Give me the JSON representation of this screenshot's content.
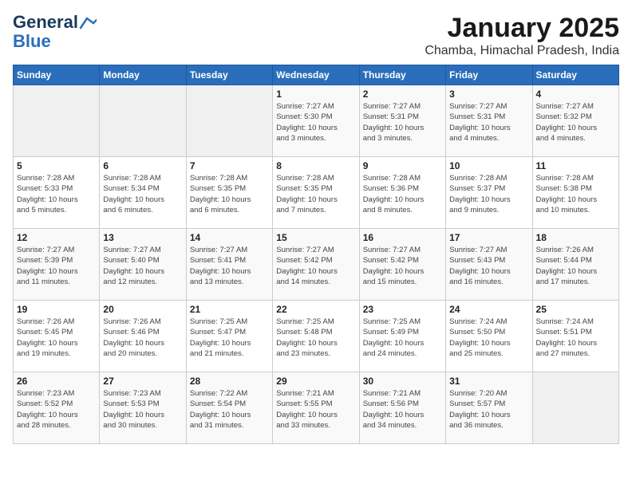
{
  "header": {
    "logo_line1": "General",
    "logo_line2": "Blue",
    "month_year": "January 2025",
    "location": "Chamba, Himachal Pradesh, India"
  },
  "days_of_week": [
    "Sunday",
    "Monday",
    "Tuesday",
    "Wednesday",
    "Thursday",
    "Friday",
    "Saturday"
  ],
  "weeks": [
    [
      {
        "day": "",
        "info": ""
      },
      {
        "day": "",
        "info": ""
      },
      {
        "day": "",
        "info": ""
      },
      {
        "day": "1",
        "info": "Sunrise: 7:27 AM\nSunset: 5:30 PM\nDaylight: 10 hours\nand 3 minutes."
      },
      {
        "day": "2",
        "info": "Sunrise: 7:27 AM\nSunset: 5:31 PM\nDaylight: 10 hours\nand 3 minutes."
      },
      {
        "day": "3",
        "info": "Sunrise: 7:27 AM\nSunset: 5:31 PM\nDaylight: 10 hours\nand 4 minutes."
      },
      {
        "day": "4",
        "info": "Sunrise: 7:27 AM\nSunset: 5:32 PM\nDaylight: 10 hours\nand 4 minutes."
      }
    ],
    [
      {
        "day": "5",
        "info": "Sunrise: 7:28 AM\nSunset: 5:33 PM\nDaylight: 10 hours\nand 5 minutes."
      },
      {
        "day": "6",
        "info": "Sunrise: 7:28 AM\nSunset: 5:34 PM\nDaylight: 10 hours\nand 6 minutes."
      },
      {
        "day": "7",
        "info": "Sunrise: 7:28 AM\nSunset: 5:35 PM\nDaylight: 10 hours\nand 6 minutes."
      },
      {
        "day": "8",
        "info": "Sunrise: 7:28 AM\nSunset: 5:35 PM\nDaylight: 10 hours\nand 7 minutes."
      },
      {
        "day": "9",
        "info": "Sunrise: 7:28 AM\nSunset: 5:36 PM\nDaylight: 10 hours\nand 8 minutes."
      },
      {
        "day": "10",
        "info": "Sunrise: 7:28 AM\nSunset: 5:37 PM\nDaylight: 10 hours\nand 9 minutes."
      },
      {
        "day": "11",
        "info": "Sunrise: 7:28 AM\nSunset: 5:38 PM\nDaylight: 10 hours\nand 10 minutes."
      }
    ],
    [
      {
        "day": "12",
        "info": "Sunrise: 7:27 AM\nSunset: 5:39 PM\nDaylight: 10 hours\nand 11 minutes."
      },
      {
        "day": "13",
        "info": "Sunrise: 7:27 AM\nSunset: 5:40 PM\nDaylight: 10 hours\nand 12 minutes."
      },
      {
        "day": "14",
        "info": "Sunrise: 7:27 AM\nSunset: 5:41 PM\nDaylight: 10 hours\nand 13 minutes."
      },
      {
        "day": "15",
        "info": "Sunrise: 7:27 AM\nSunset: 5:42 PM\nDaylight: 10 hours\nand 14 minutes."
      },
      {
        "day": "16",
        "info": "Sunrise: 7:27 AM\nSunset: 5:42 PM\nDaylight: 10 hours\nand 15 minutes."
      },
      {
        "day": "17",
        "info": "Sunrise: 7:27 AM\nSunset: 5:43 PM\nDaylight: 10 hours\nand 16 minutes."
      },
      {
        "day": "18",
        "info": "Sunrise: 7:26 AM\nSunset: 5:44 PM\nDaylight: 10 hours\nand 17 minutes."
      }
    ],
    [
      {
        "day": "19",
        "info": "Sunrise: 7:26 AM\nSunset: 5:45 PM\nDaylight: 10 hours\nand 19 minutes."
      },
      {
        "day": "20",
        "info": "Sunrise: 7:26 AM\nSunset: 5:46 PM\nDaylight: 10 hours\nand 20 minutes."
      },
      {
        "day": "21",
        "info": "Sunrise: 7:25 AM\nSunset: 5:47 PM\nDaylight: 10 hours\nand 21 minutes."
      },
      {
        "day": "22",
        "info": "Sunrise: 7:25 AM\nSunset: 5:48 PM\nDaylight: 10 hours\nand 23 minutes."
      },
      {
        "day": "23",
        "info": "Sunrise: 7:25 AM\nSunset: 5:49 PM\nDaylight: 10 hours\nand 24 minutes."
      },
      {
        "day": "24",
        "info": "Sunrise: 7:24 AM\nSunset: 5:50 PM\nDaylight: 10 hours\nand 25 minutes."
      },
      {
        "day": "25",
        "info": "Sunrise: 7:24 AM\nSunset: 5:51 PM\nDaylight: 10 hours\nand 27 minutes."
      }
    ],
    [
      {
        "day": "26",
        "info": "Sunrise: 7:23 AM\nSunset: 5:52 PM\nDaylight: 10 hours\nand 28 minutes."
      },
      {
        "day": "27",
        "info": "Sunrise: 7:23 AM\nSunset: 5:53 PM\nDaylight: 10 hours\nand 30 minutes."
      },
      {
        "day": "28",
        "info": "Sunrise: 7:22 AM\nSunset: 5:54 PM\nDaylight: 10 hours\nand 31 minutes."
      },
      {
        "day": "29",
        "info": "Sunrise: 7:21 AM\nSunset: 5:55 PM\nDaylight: 10 hours\nand 33 minutes."
      },
      {
        "day": "30",
        "info": "Sunrise: 7:21 AM\nSunset: 5:56 PM\nDaylight: 10 hours\nand 34 minutes."
      },
      {
        "day": "31",
        "info": "Sunrise: 7:20 AM\nSunset: 5:57 PM\nDaylight: 10 hours\nand 36 minutes."
      },
      {
        "day": "",
        "info": ""
      }
    ]
  ]
}
